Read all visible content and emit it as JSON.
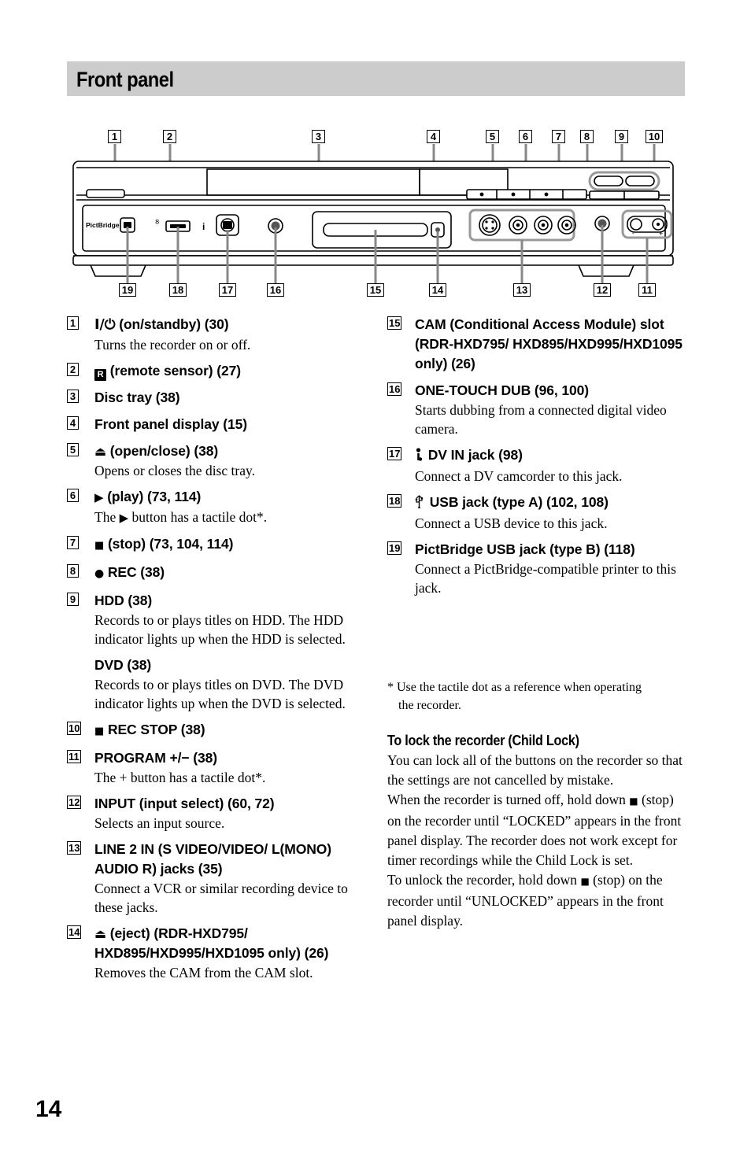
{
  "page": {
    "title": "Front panel",
    "number": "14",
    "band_color": "#cccccc"
  },
  "diagram": {
    "name": "front-panel-illustration",
    "device_label": "PictBridge",
    "callouts_top": [
      "1",
      "2",
      "3",
      "4",
      "5",
      "6",
      "7",
      "8",
      "9",
      "10"
    ],
    "callouts_bottom": [
      "19",
      "18",
      "17",
      "16",
      "15",
      "14",
      "13",
      "12",
      "11"
    ],
    "rocker_minus": "-",
    "rocker_plus": "+"
  },
  "left_column": [
    {
      "num": "1",
      "glyph": "I/⏻",
      "head": " (on/standby) (30)",
      "desc": "Turns the recorder on or off."
    },
    {
      "num": "2",
      "glyph_icon": "remote-sensor",
      "icon_letter": "R",
      "head": " (remote sensor) (27)",
      "desc": ""
    },
    {
      "num": "3",
      "head": "Disc tray (38)",
      "desc": ""
    },
    {
      "num": "4",
      "head": "Front panel display (15)",
      "desc": ""
    },
    {
      "num": "5",
      "glyph": "⏏",
      "head": " (open/close) (38)",
      "desc": "Opens or closes the disc tray."
    },
    {
      "num": "6",
      "glyph": "▶",
      "head": " (play) (73, 114)",
      "desc_pre": "The ",
      "desc_glyph": "▶",
      "desc_post": " button has a tactile dot*."
    },
    {
      "num": "7",
      "glyph": "■",
      "head": " (stop) (73, 104, 114)",
      "desc": ""
    },
    {
      "num": "8",
      "glyph": "●",
      "head": " REC (38)",
      "desc": ""
    },
    {
      "num": "9",
      "head": "HDD (38)",
      "desc": "Records to or plays titles on HDD. The HDD indicator lights up when the HDD is selected."
    },
    {
      "num": "",
      "head": "DVD (38)",
      "desc": "Records to or plays titles on DVD. The DVD indicator lights up when the DVD is selected."
    },
    {
      "num": "10",
      "glyph": "■",
      "head": " REC STOP (38)",
      "desc": ""
    },
    {
      "num": "11",
      "head": "PROGRAM +/− (38)",
      "desc": "The + button has a tactile dot*."
    },
    {
      "num": "12",
      "head": "INPUT (input select) (60, 72)",
      "desc": "Selects an input source."
    },
    {
      "num": "13",
      "head": "LINE 2 IN (S VIDEO/VIDEO/ L(MONO) AUDIO R) jacks (35)",
      "desc": "Connect a VCR or similar recording device to these jacks."
    },
    {
      "num": "14",
      "glyph": "⏏",
      "head": " (eject) (RDR-HXD795/ HXD895/HXD995/HXD1095 only) (26)",
      "desc": "Removes the CAM from the CAM slot."
    }
  ],
  "right_column": [
    {
      "num": "15",
      "head": "CAM (Conditional Access Module) slot (RDR-HXD795/ HXD895/HXD995/HXD1095 only) (26)",
      "desc": ""
    },
    {
      "num": "16",
      "head": "ONE-TOUCH DUB (96, 100)",
      "desc": "Starts dubbing from a connected digital video camera."
    },
    {
      "num": "17",
      "glyph_icon": "ilink",
      "head": " DV IN jack (98)",
      "desc": "Connect a DV camcorder to this jack."
    },
    {
      "num": "18",
      "glyph_icon": "usb",
      "head": " USB jack (type A) (102, 108)",
      "desc": "Connect a USB device to this jack."
    },
    {
      "num": "19",
      "head": "PictBridge USB jack (type B) (118)",
      "desc": "Connect a PictBridge-compatible printer to this jack."
    }
  ],
  "footnote": {
    "line1": "* Use the tactile dot as a reference when operating",
    "line2": "the recorder."
  },
  "child_lock": {
    "heading": "To lock the recorder (Child Lock)",
    "para1": "You can lock all of the buttons on the recorder so that the settings are not cancelled by mistake.",
    "para2_pre": "When the recorder is turned off, hold down ",
    "para2_glyph": "■",
    "para2_post": " (stop) on the recorder until “LOCKED” appears in the front panel display. The recorder does not work except for timer recordings while the Child Lock is set.",
    "para3_pre": "To unlock the recorder, hold down ",
    "para3_glyph": "■",
    "para3_post": " (stop) on the recorder until “UNLOCKED” appears in the front panel display."
  }
}
